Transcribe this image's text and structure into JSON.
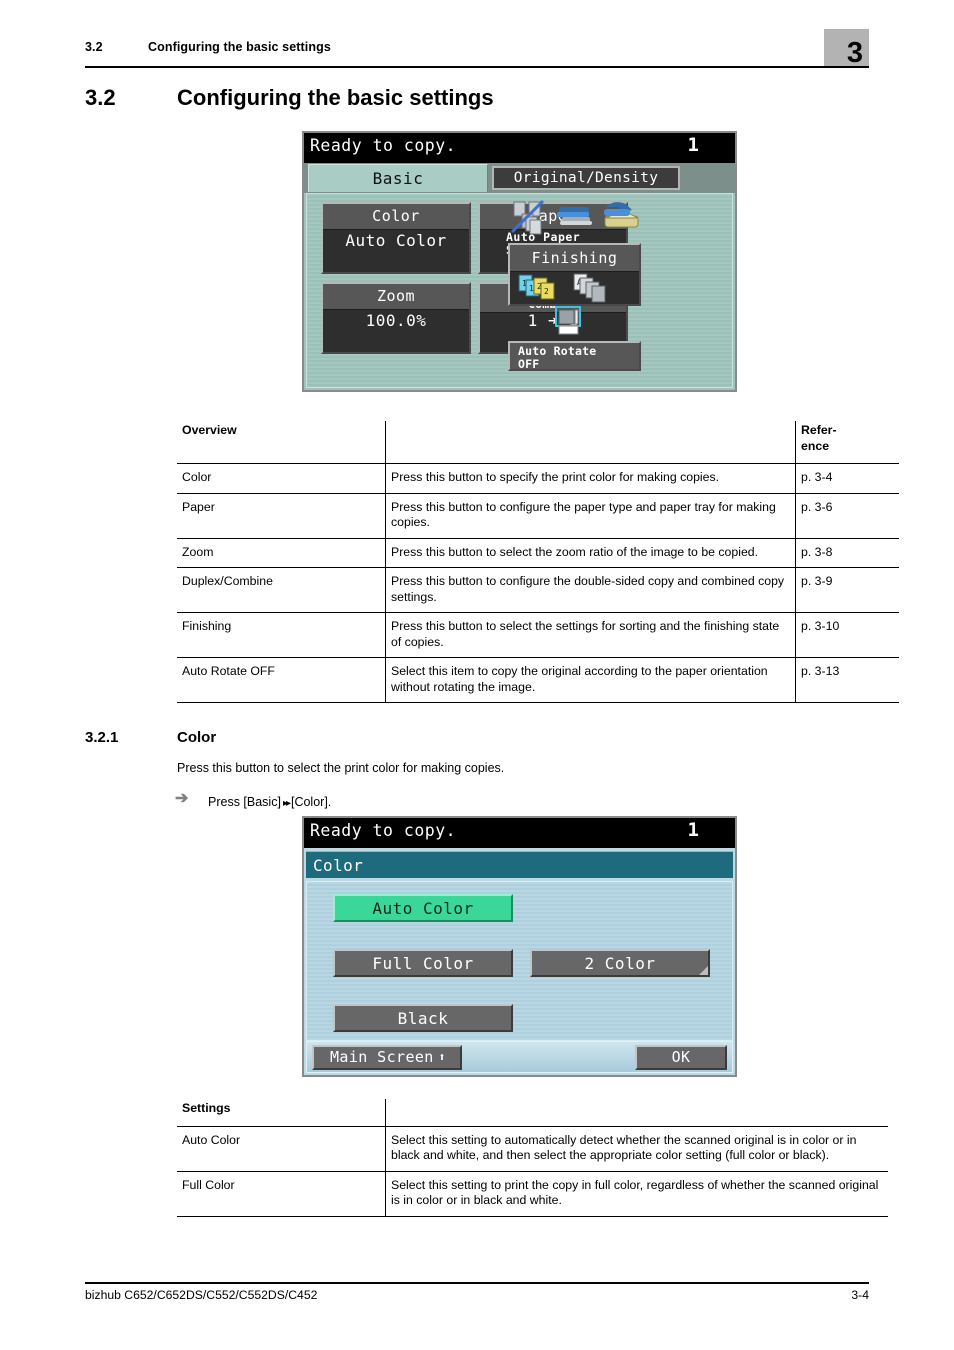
{
  "header": {
    "section_number": "3.2",
    "section_title": "Configuring the basic settings",
    "chapter_badge": "3"
  },
  "section_main": {
    "number": "3.2",
    "title": "Configuring the basic settings"
  },
  "lcd_basic": {
    "status_message": "Ready to copy.",
    "copy_count": "1",
    "tab_basic": "Basic",
    "tab_original_density": "Original/Density",
    "buttons": {
      "color": {
        "label": "Color",
        "value": "Auto Color"
      },
      "paper": {
        "label": "Paper",
        "value_line1": "Auto Paper",
        "value_line2": "Select"
      },
      "zoom": {
        "label": "Zoom",
        "value": "100.0%"
      },
      "duplex": {
        "label_line1": "Duplex/",
        "label_line2": "Combine",
        "value": "1  ➜  1"
      },
      "finishing": {
        "label": "Finishing"
      },
      "auto_rotate": {
        "label_line1": "Auto Rotate",
        "label_line2": "OFF"
      }
    }
  },
  "table_overview": {
    "columns": [
      "Overview",
      "",
      "Refer-\nence"
    ],
    "col1_header": "Overview",
    "col3_header_line1": "Refer-",
    "col3_header_line2": "ence",
    "rows": [
      {
        "name": "Color",
        "description": "Press this button to specify the print color for making copies.",
        "reference": "p. 3-4"
      },
      {
        "name": "Paper",
        "description": "Press this button to configure the paper type and paper tray for making copies.",
        "reference": "p. 3-6"
      },
      {
        "name": "Zoom",
        "description": "Press this button to select the zoom ratio of the image to be copied.",
        "reference": "p. 3-8"
      },
      {
        "name": "Duplex/Combine",
        "description": "Press this button to configure the double-sided copy and combined copy settings.",
        "reference": "p. 3-9"
      },
      {
        "name": "Finishing",
        "description": "Press this button to select the settings for sorting and the finishing state of copies.",
        "reference": "p. 3-10"
      },
      {
        "name": "Auto Rotate OFF",
        "description": "Select this item to copy the original according to the paper orientation without rotating the image.",
        "reference": "p. 3-13"
      }
    ]
  },
  "subsection": {
    "number": "3.2.1",
    "title": "Color",
    "paragraph": "Press this button to select the print color for making copies.",
    "step_prefix": "Press [Basic]",
    "step_suffix": "[Color]."
  },
  "lcd_color": {
    "status_message": "Ready to copy.",
    "copy_count": "1",
    "screen_title": "Color",
    "options": [
      {
        "label": "Auto Color",
        "selected": true
      },
      {
        "label": "Full Color",
        "selected": false
      },
      {
        "label": "2 Color",
        "selected": false
      },
      {
        "label": "Black",
        "selected": false
      }
    ],
    "footer": {
      "main_screen": "Main Screen",
      "ok": "OK"
    }
  },
  "table_settings": {
    "col1_header": "Settings",
    "rows": [
      {
        "name": "Auto Color",
        "description": "Select this setting to automatically detect whether the scanned original is in color or in black and white, and then select the appropriate color setting (full color or black)."
      },
      {
        "name": "Full Color",
        "description": "Select this setting to print the copy in full color, regardless of whether the scanned original is in color or in black and white."
      }
    ]
  },
  "footer": {
    "model": "bizhub C652/C652DS/C552/C552DS/C452",
    "page": "3-4"
  },
  "colors": {
    "lcd_basic_bg": "#9fc3bb",
    "lcd_color_bg": "#bcd9e4",
    "selected_button": "#3bd79a",
    "title_bar": "#1e6b7d",
    "badge_gray": "#b3b3b3"
  }
}
